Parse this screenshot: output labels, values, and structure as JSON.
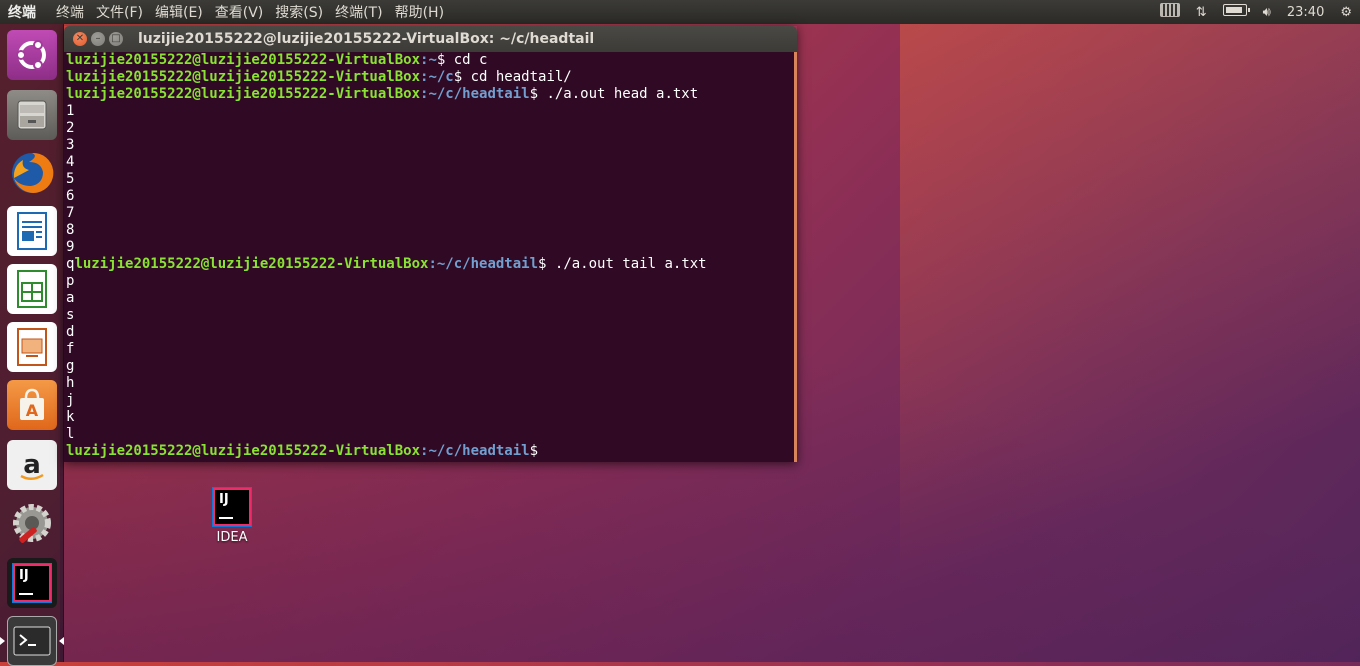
{
  "top_panel": {
    "app_name": "终端",
    "menus": [
      "终端",
      "文件(F)",
      "编辑(E)",
      "查看(V)",
      "搜索(S)",
      "终端(T)",
      "帮助(H)"
    ],
    "clock": "23:40"
  },
  "launcher": {
    "items": [
      "ubuntu-dash",
      "files",
      "firefox",
      "libreoffice-writer",
      "libreoffice-calc",
      "libreoffice-impress",
      "software-center",
      "amazon",
      "system-settings",
      "intellij-idea",
      "terminal"
    ]
  },
  "terminal": {
    "title": "luzijie20155222@luzijie20155222-VirtualBox: ~/c/headtail",
    "lines": [
      {
        "pre": "",
        "user": "luzijie20155222@luzijie20155222-VirtualBox",
        "path": ":~",
        "cmd": "$ cd c"
      },
      {
        "pre": "",
        "user": "luzijie20155222@luzijie20155222-VirtualBox",
        "path": ":~/c",
        "cmd": "$ cd headtail/"
      },
      {
        "pre": "",
        "user": "luzijie20155222@luzijie20155222-VirtualBox",
        "path": ":~/c/headtail",
        "cmd": "$ ./a.out head a.txt"
      },
      {
        "text": "1"
      },
      {
        "text": "2"
      },
      {
        "text": "3"
      },
      {
        "text": "4"
      },
      {
        "text": "5"
      },
      {
        "text": "6"
      },
      {
        "text": "7"
      },
      {
        "text": "8"
      },
      {
        "text": "9"
      },
      {
        "pre": "q",
        "user": "luzijie20155222@luzijie20155222-VirtualBox",
        "path": ":~/c/headtail",
        "cmd": "$ ./a.out tail a.txt"
      },
      {
        "text": "p"
      },
      {
        "text": "a"
      },
      {
        "text": "s"
      },
      {
        "text": "d"
      },
      {
        "text": "f"
      },
      {
        "text": "g"
      },
      {
        "text": "h"
      },
      {
        "text": "j"
      },
      {
        "text": "k"
      },
      {
        "text": "l"
      },
      {
        "pre": "",
        "user": "luzijie20155222@luzijie20155222-VirtualBox",
        "path": ":~/c/headtail",
        "cmd": "$"
      }
    ]
  },
  "desktop": {
    "idea_label": "IDEA",
    "idea_logo_text": "IJ"
  },
  "colors": {
    "terminal_bg": "#300a24",
    "prompt_user": "#8ae234",
    "prompt_path": "#729fcf",
    "close_button": "#e05a2a"
  }
}
